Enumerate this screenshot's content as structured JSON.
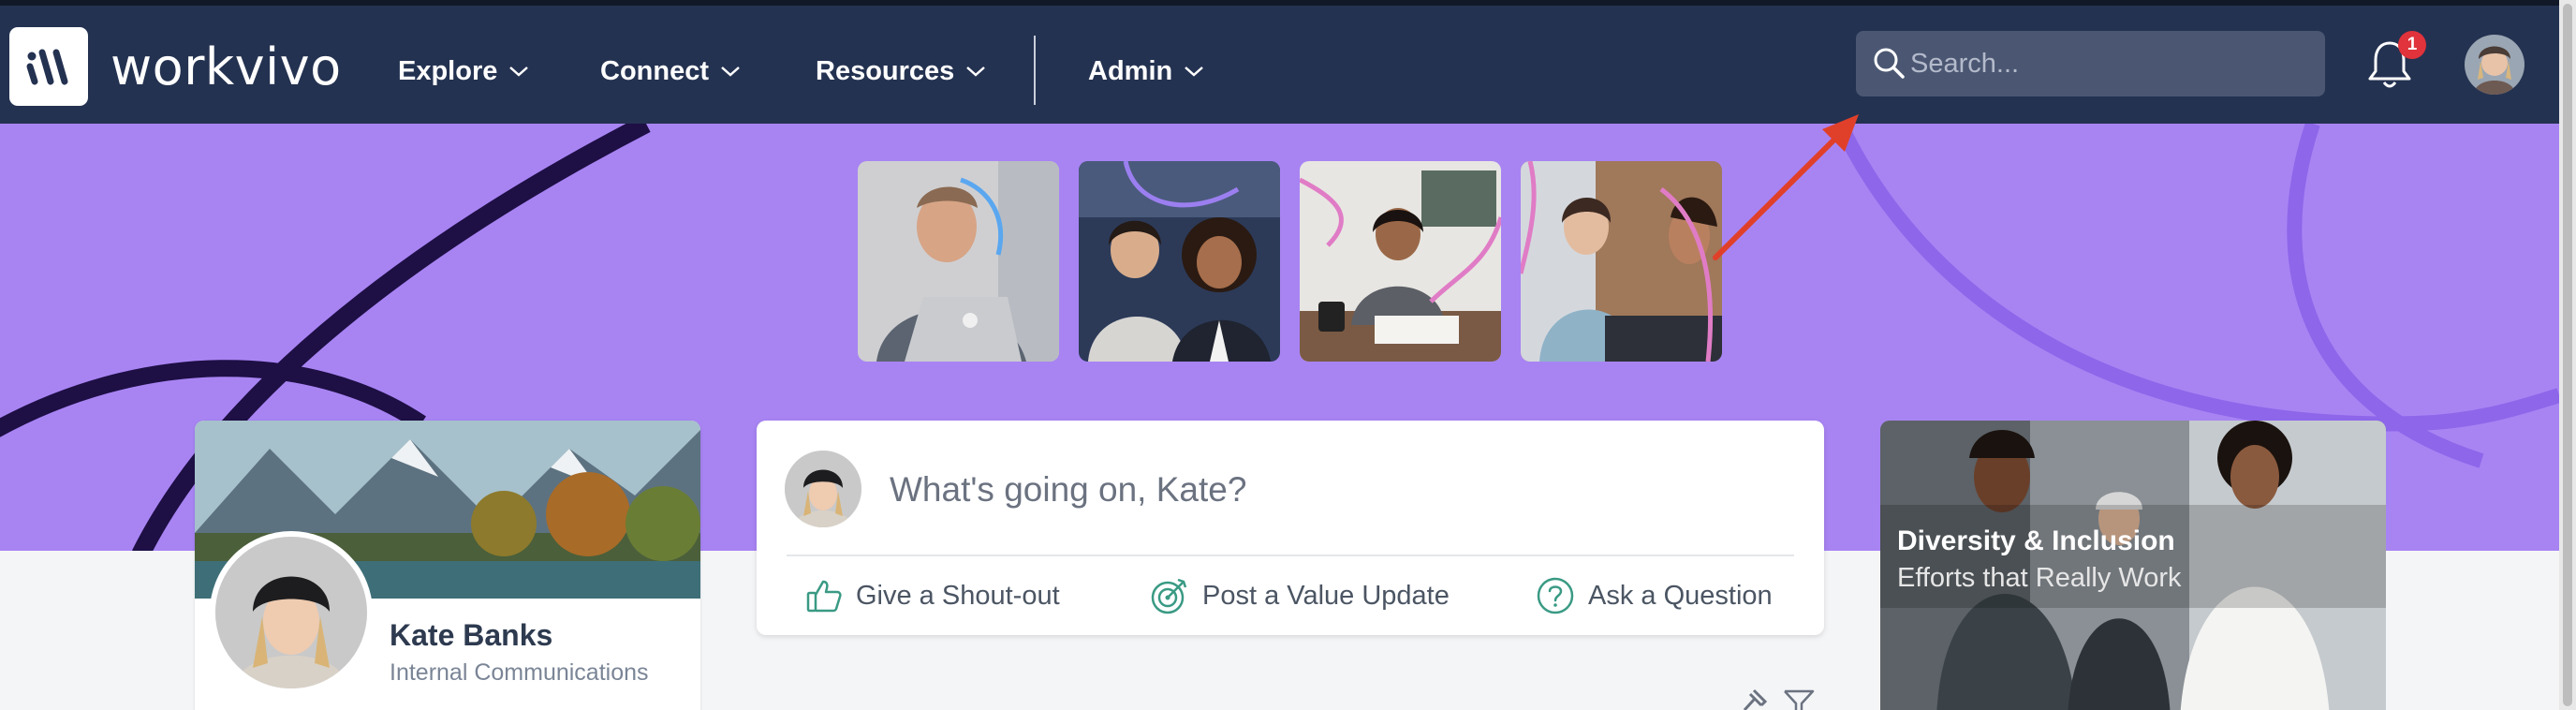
{
  "brand": {
    "name": "workvivo",
    "color": "#243251",
    "accent": "#a884f3"
  },
  "nav": {
    "items": [
      {
        "label": "Explore",
        "icon": "chevron-down-icon"
      },
      {
        "label": "Connect",
        "icon": "chevron-down-icon"
      },
      {
        "label": "Resources",
        "icon": "chevron-down-icon"
      },
      {
        "label": "Admin",
        "icon": "chevron-down-icon"
      }
    ],
    "search_placeholder": "Search...",
    "notification_count": "1"
  },
  "hero": {
    "photos": [
      "man-with-laptop",
      "two-women-smiling",
      "woman-writing-at-desk",
      "colleagues-meeting"
    ]
  },
  "profile": {
    "name": "Kate Banks",
    "role": "Internal Communications"
  },
  "composer": {
    "placeholder": "What's going on, Kate?",
    "actions": [
      {
        "label": "Give a Shout-out",
        "icon": "thumbs-up-icon"
      },
      {
        "label": "Post a Value Update",
        "icon": "target-icon"
      },
      {
        "label": "Ask a Question",
        "icon": "question-circle-icon"
      }
    ]
  },
  "featured": {
    "title": "Diversity & Inclusion",
    "subtitle": "Efforts that Really Work"
  },
  "annotation": {
    "color": "#e0402a",
    "icon": "red-arrow"
  }
}
